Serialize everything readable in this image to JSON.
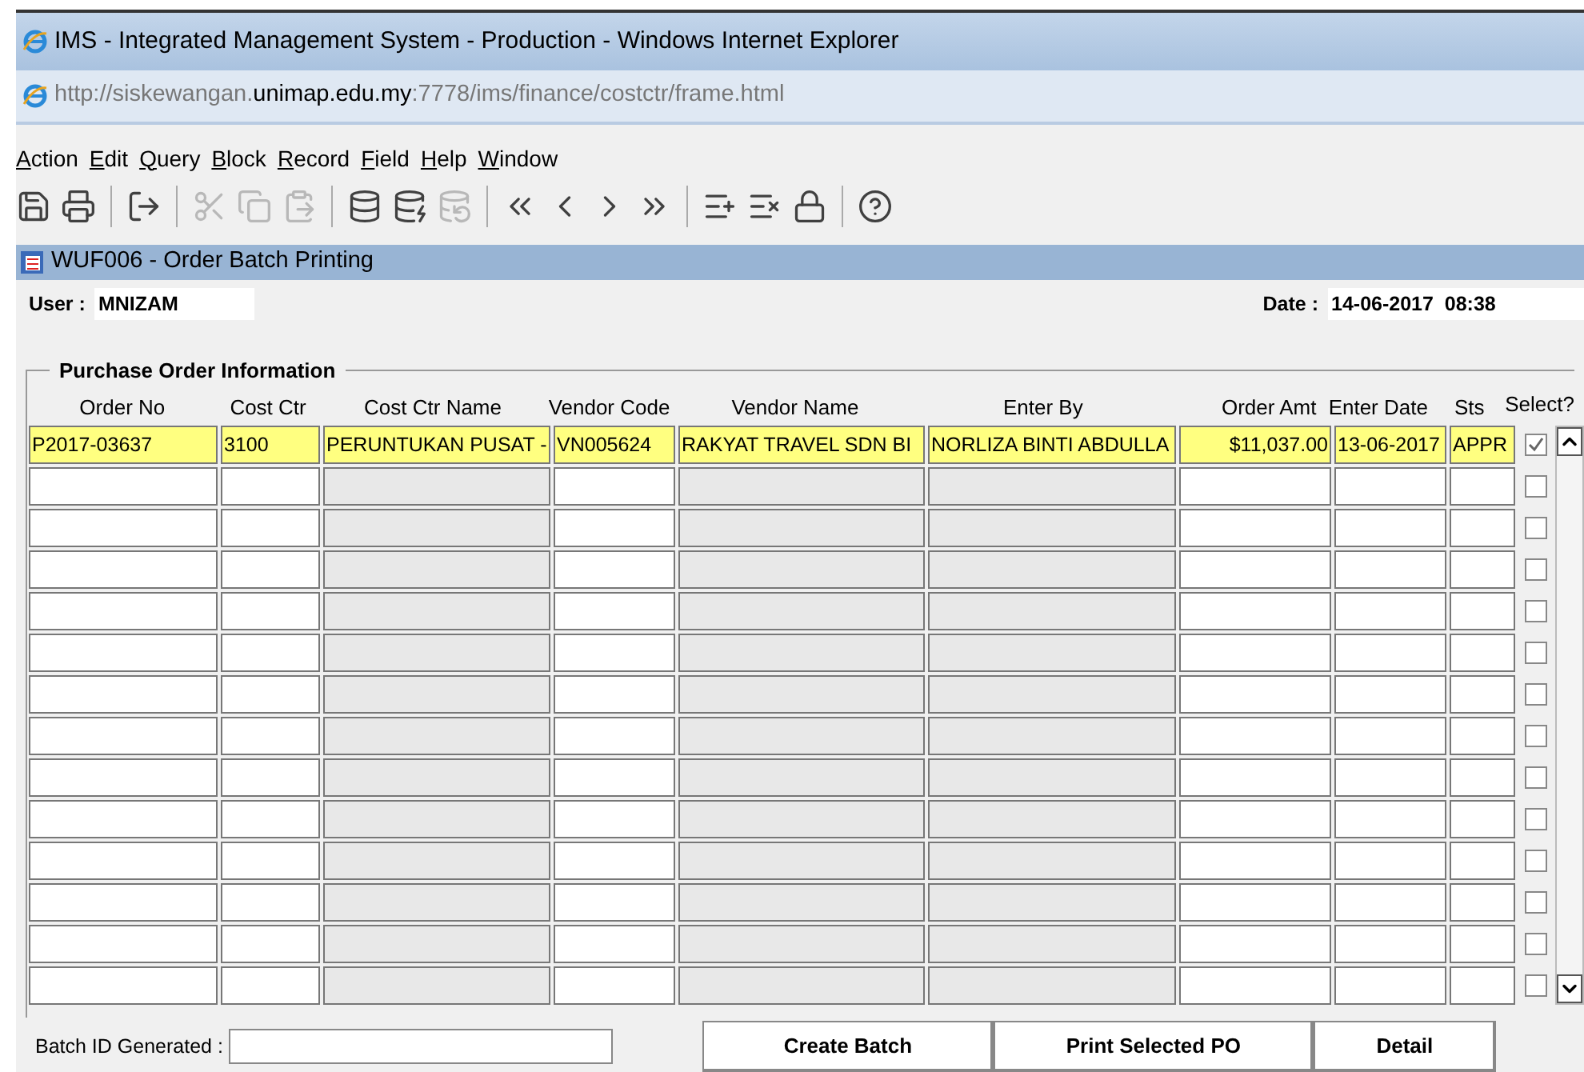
{
  "window": {
    "title": "IMS - Integrated Management System - Production - Windows Internet Explorer"
  },
  "address": {
    "prefix": "http://siskewangan.",
    "domain": "unimap.edu.my",
    "suffix": ":7778/ims/finance/costctr/frame.html"
  },
  "menu": [
    "Action",
    "Edit",
    "Query",
    "Block",
    "Record",
    "Field",
    "Help",
    "Window"
  ],
  "toolbar": [
    {
      "kind": "save",
      "disabled": false
    },
    {
      "kind": "print",
      "disabled": false
    },
    {
      "kind": "sep"
    },
    {
      "kind": "exit",
      "disabled": false
    },
    {
      "kind": "sep"
    },
    {
      "kind": "cut",
      "disabled": true
    },
    {
      "kind": "copy",
      "disabled": true
    },
    {
      "kind": "paste",
      "disabled": true
    },
    {
      "kind": "sep"
    },
    {
      "kind": "query",
      "disabled": false
    },
    {
      "kind": "execute",
      "disabled": false
    },
    {
      "kind": "cancel",
      "disabled": true
    },
    {
      "kind": "sep"
    },
    {
      "kind": "first",
      "disabled": false
    },
    {
      "kind": "prev",
      "disabled": false
    },
    {
      "kind": "next",
      "disabled": false
    },
    {
      "kind": "last",
      "disabled": false
    },
    {
      "kind": "sep"
    },
    {
      "kind": "insert",
      "disabled": false
    },
    {
      "kind": "delete",
      "disabled": false
    },
    {
      "kind": "lock",
      "disabled": false
    },
    {
      "kind": "sep"
    },
    {
      "kind": "help",
      "disabled": false
    }
  ],
  "form": {
    "title": "WUF006 - Order Batch Printing",
    "user_label": "User :",
    "user": "MNIZAM",
    "date_label": "Date :",
    "date": "14-06-2017  08:38"
  },
  "group": {
    "title": "Purchase Order Information"
  },
  "table": {
    "columns": [
      {
        "label": "Order No",
        "readonly": false,
        "kind": "text"
      },
      {
        "label": "Cost Ctr",
        "readonly": false,
        "kind": "text"
      },
      {
        "label": "Cost Ctr Name",
        "readonly": true,
        "kind": "text"
      },
      {
        "label": "Vendor Code",
        "readonly": false,
        "kind": "text"
      },
      {
        "label": "Vendor Name",
        "readonly": true,
        "kind": "text"
      },
      {
        "label": "Enter By",
        "readonly": true,
        "kind": "text"
      },
      {
        "label": "Order Amt",
        "readonly": false,
        "kind": "amount"
      },
      {
        "label": "Enter Date",
        "readonly": false,
        "kind": "text"
      },
      {
        "label": "Sts",
        "readonly": false,
        "kind": "text"
      }
    ],
    "select_label": "Select?",
    "rows": [
      {
        "current": true,
        "checked": true,
        "cells": [
          "P2017-03637",
          "3100",
          "PERUNTUKAN PUSAT -",
          "VN005624",
          "RAKYAT TRAVEL SDN BI",
          "NORLIZA BINTI ABDULLA",
          "$11,037.00",
          "13-06-2017",
          "APPR"
        ]
      },
      {
        "current": false,
        "checked": false,
        "cells": []
      },
      {
        "current": false,
        "checked": false,
        "cells": []
      },
      {
        "current": false,
        "checked": false,
        "cells": []
      },
      {
        "current": false,
        "checked": false,
        "cells": []
      },
      {
        "current": false,
        "checked": false,
        "cells": []
      },
      {
        "current": false,
        "checked": false,
        "cells": []
      },
      {
        "current": false,
        "checked": false,
        "cells": []
      },
      {
        "current": false,
        "checked": false,
        "cells": []
      },
      {
        "current": false,
        "checked": false,
        "cells": []
      },
      {
        "current": false,
        "checked": false,
        "cells": []
      },
      {
        "current": false,
        "checked": false,
        "cells": []
      },
      {
        "current": false,
        "checked": false,
        "cells": []
      },
      {
        "current": false,
        "checked": false,
        "cells": []
      }
    ]
  },
  "footer": {
    "batch_label": "Batch ID Generated :",
    "buttons": [
      "Create Batch",
      "Print Selected PO",
      "Detail"
    ]
  }
}
